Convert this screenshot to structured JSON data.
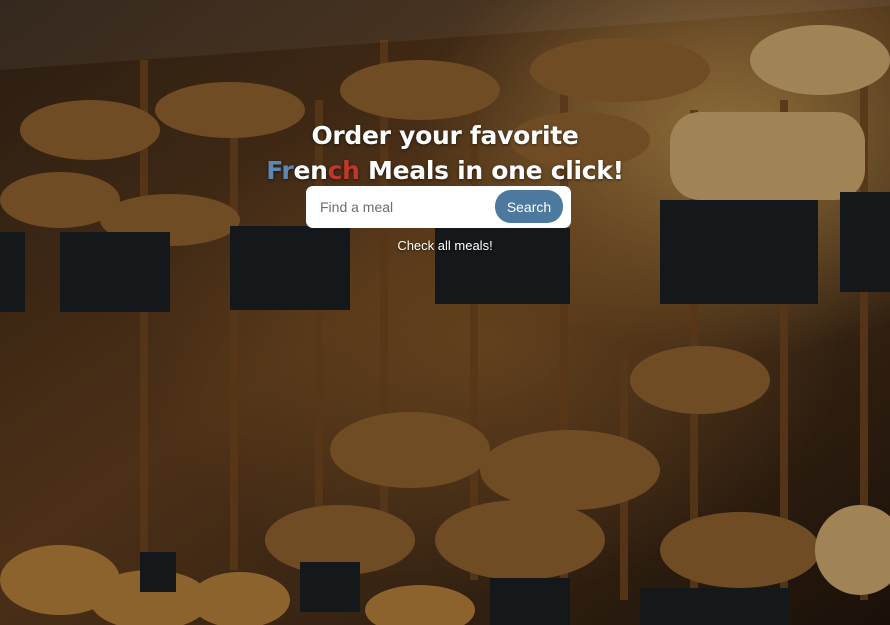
{
  "hero": {
    "title_line1": "Order your favorite",
    "title_fr_part1": "Fr",
    "title_fr_part2": "en",
    "title_fr_part3": "ch",
    "title_line2_rest": " Meals in one click!",
    "background_image": "bakery-bread-shelves-photo"
  },
  "search": {
    "placeholder": "Find a meal",
    "value": "",
    "button_label": "Search"
  },
  "links": {
    "all_meals": "Check all meals!"
  },
  "colors": {
    "accent": "#4d799f",
    "french_blue": "#5d87b3",
    "french_red": "#c0382b"
  }
}
